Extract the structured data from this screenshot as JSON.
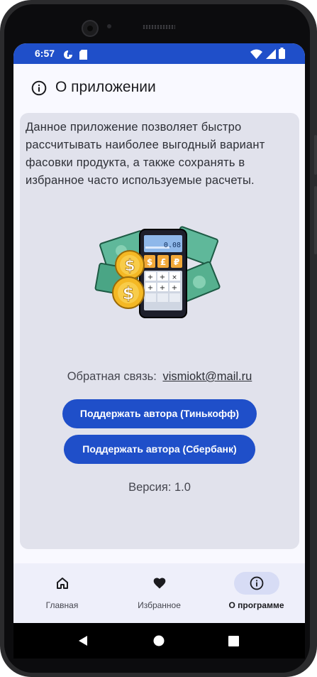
{
  "status": {
    "time": "6:57"
  },
  "header": {
    "title": "О приложении"
  },
  "about": {
    "description": "Данное приложение позволяет быстро рассчитывать наиболее выгодный вариант фасовки продукта, а также сохранять в избранное часто используемые расчеты.",
    "calculator_display": "0.08",
    "feedback_label": "Обратная связь:",
    "feedback_email": "vismiokt@mail.ru",
    "support_tinkoff": "Поддержать автора (Тинькофф)",
    "support_sber": "Поддержать автора (Сбербанк)",
    "version": "Версия: 1.0"
  },
  "nav": {
    "items": [
      {
        "label": "Главная",
        "icon": "home-icon",
        "active": false
      },
      {
        "label": "Избранное",
        "icon": "heart-icon",
        "active": false
      },
      {
        "label": "О программе",
        "icon": "info-icon",
        "active": true
      }
    ]
  },
  "colors": {
    "accent": "#1f4fc9",
    "card": "#e1e2ec",
    "nav_bg": "#eeeffa",
    "nav_active": "#d7dcf5"
  }
}
